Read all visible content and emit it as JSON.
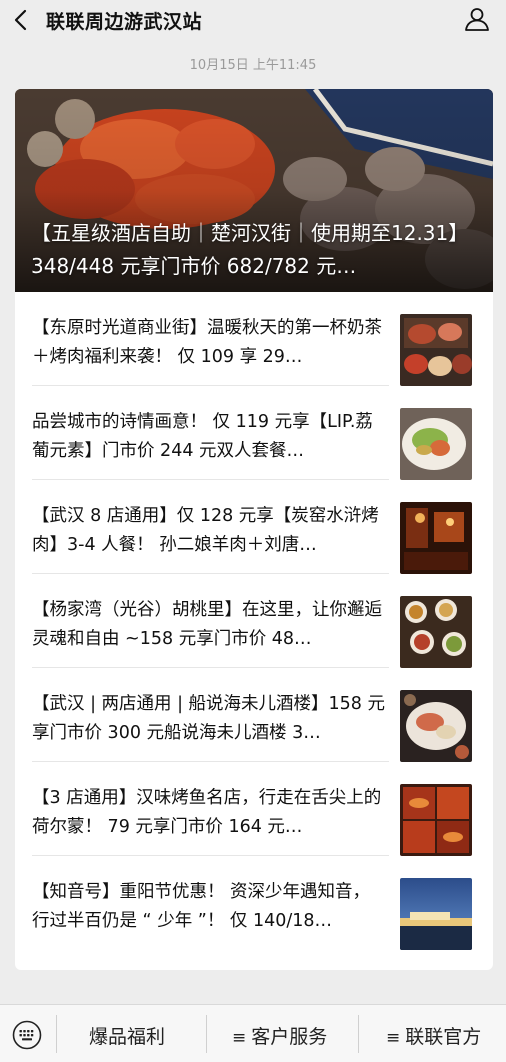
{
  "header": {
    "title": "联联周边游武汉站",
    "back_icon": "chevron-left-icon",
    "profile_icon": "person-icon"
  },
  "timestamp": "10月15日 上午11:45",
  "hero": {
    "title": "【五星级酒店自助｜楚河汉街｜使用期至12.31】348/448 元享门市价 682/782 元…"
  },
  "articles": [
    {
      "title": "【东原时光道商业街】温暖秋天的第一杯奶茶＋烤肉福利来袭！ 仅 109 享 29…"
    },
    {
      "title": "品尝城市的诗情画意！ 仅 119 元享【LIP.荔葡元素】门市价 244 元双人套餐…"
    },
    {
      "title": "【武汉 8 店通用】仅 128 元享【炭窑水浒烤肉】3-4 人餐！ 孙二娘羊肉＋刘唐…"
    },
    {
      "title": "【杨家湾（光谷）胡桃里】在这里，让你邂逅灵魂和自由 ~158 元享门市价 48…"
    },
    {
      "title": "【武汉 | 两店通用 | 船说海未儿酒楼】158 元享门市价 300 元船说海未儿酒楼 3…"
    },
    {
      "title": "【3 店通用】汉味烤鱼名店，行走在舌尖上的荷尔蒙！ 79 元享门市价 164 元…"
    },
    {
      "title": "【知音号】重阳节优惠！ 资深少年遇知音，行过半百仍是 “ 少年 ”！ 仅 140/18…"
    }
  ],
  "menu": {
    "keyboard_icon": "keyboard-icon",
    "items": [
      {
        "label": "爆品福利",
        "icon": ""
      },
      {
        "label": "客户服务",
        "icon": "≡"
      },
      {
        "label": "联联官方",
        "icon": "≡"
      }
    ]
  }
}
